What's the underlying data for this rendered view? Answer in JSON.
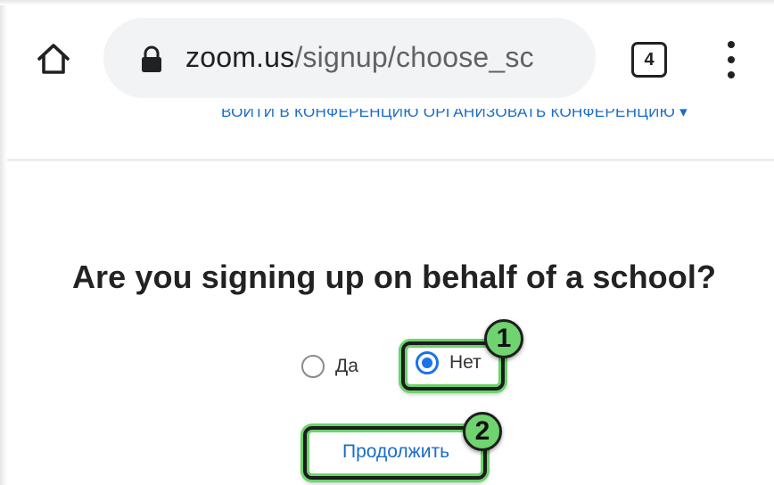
{
  "browser": {
    "url_host": "zoom.us",
    "url_path": "/signup/choose_sc",
    "tab_count": "4",
    "icons": {
      "home": "home-icon",
      "lock": "lock-icon",
      "menu": "more-vert-icon"
    }
  },
  "site_nav": {
    "text": "ВОЙТИ В КОНФЕРЕНЦИЮ  ОРГАНИЗОВАТЬ КОНФЕРЕНЦИЮ ▾"
  },
  "signup": {
    "question": "Are you signing up on behalf of a school?",
    "options": [
      {
        "label": "Да",
        "selected": false
      },
      {
        "label": "Нет",
        "selected": true
      }
    ],
    "continue_label": "Продолжить"
  },
  "callouts": [
    {
      "number": "1"
    },
    {
      "number": "2"
    }
  ],
  "colors": {
    "accent": "#1a73e8",
    "link": "#1a6cc9",
    "callout": "#6fd36f"
  }
}
